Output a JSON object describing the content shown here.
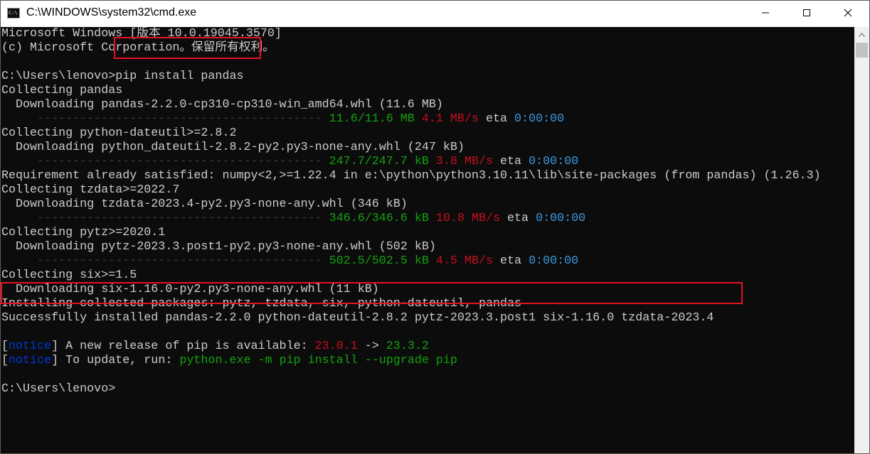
{
  "window": {
    "title": "C:\\WINDOWS\\system32\\cmd.exe",
    "app_icon_text": "C:\\"
  },
  "controls": {
    "minimize_icon": "minimize-icon",
    "maximize_icon": "maximize-icon",
    "close_icon": "close-icon"
  },
  "colors": {
    "background": "#0c0c0c",
    "text": "#cccccc",
    "green": "#13a10e",
    "red": "#c50f1f",
    "blue": "#3a96dd",
    "notice_blue": "#0037da",
    "highlight_box": "#e81123"
  },
  "console": {
    "lines": [
      [
        {
          "text": "Microsoft Windows [版本 10.0.19045.3570]"
        }
      ],
      [
        {
          "text": "(c) Microsoft Corporation。保留所有权利。"
        }
      ],
      [
        {
          "text": ""
        }
      ],
      [
        {
          "text": "C:\\Users\\lenovo>pip install pandas"
        }
      ],
      [
        {
          "text": "Collecting pandas"
        }
      ],
      [
        {
          "text": "  Downloading pandas-2.2.0-cp310-cp310-win_amd64.whl (11.6 MB)"
        }
      ],
      [
        {
          "text": "     ---------------------------------------- ",
          "color": "dash"
        },
        {
          "text": "11.6/11.6 MB",
          "color": "green"
        },
        {
          "text": " "
        },
        {
          "text": "4.1 MB/s",
          "color": "red"
        },
        {
          "text": " eta "
        },
        {
          "text": "0:00:00",
          "color": "blue"
        }
      ],
      [
        {
          "text": "Collecting python-dateutil>=2.8.2"
        }
      ],
      [
        {
          "text": "  Downloading python_dateutil-2.8.2-py2.py3-none-any.whl (247 kB)"
        }
      ],
      [
        {
          "text": "     ---------------------------------------- ",
          "color": "dash"
        },
        {
          "text": "247.7/247.7 kB",
          "color": "green"
        },
        {
          "text": " "
        },
        {
          "text": "3.8 MB/s",
          "color": "red"
        },
        {
          "text": " eta "
        },
        {
          "text": "0:00:00",
          "color": "blue"
        }
      ],
      [
        {
          "text": "Requirement already satisfied: numpy<2,>=1.22.4 in e:\\python\\python3.10.11\\lib\\site-packages (from pandas) (1.26.3)"
        }
      ],
      [
        {
          "text": "Collecting tzdata>=2022.7"
        }
      ],
      [
        {
          "text": "  Downloading tzdata-2023.4-py2.py3-none-any.whl (346 kB)"
        }
      ],
      [
        {
          "text": "     ---------------------------------------- ",
          "color": "dash"
        },
        {
          "text": "346.6/346.6 kB",
          "color": "green"
        },
        {
          "text": " "
        },
        {
          "text": "10.8 MB/s",
          "color": "red"
        },
        {
          "text": " eta "
        },
        {
          "text": "0:00:00",
          "color": "blue"
        }
      ],
      [
        {
          "text": "Collecting pytz>=2020.1"
        }
      ],
      [
        {
          "text": "  Downloading pytz-2023.3.post1-py2.py3-none-any.whl (502 kB)"
        }
      ],
      [
        {
          "text": "     ---------------------------------------- ",
          "color": "dash"
        },
        {
          "text": "502.5/502.5 kB",
          "color": "green"
        },
        {
          "text": " "
        },
        {
          "text": "4.5 MB/s",
          "color": "red"
        },
        {
          "text": " eta "
        },
        {
          "text": "0:00:00",
          "color": "blue"
        }
      ],
      [
        {
          "text": "Collecting six>=1.5"
        }
      ],
      [
        {
          "text": "  Downloading six-1.16.0-py2.py3-none-any.whl (11 kB)"
        }
      ],
      [
        {
          "text": "Installing collected packages: pytz, tzdata, six, python-dateutil, pandas"
        }
      ],
      [
        {
          "text": "Successfully installed pandas-2.2.0 python-dateutil-2.8.2 pytz-2023.3.post1 six-1.16.0 tzdata-2023.4"
        }
      ],
      [
        {
          "text": ""
        }
      ],
      [
        {
          "text": "["
        },
        {
          "text": "notice",
          "color": "dblue"
        },
        {
          "text": "] A new release of pip is available: "
        },
        {
          "text": "23.0.1",
          "color": "red"
        },
        {
          "text": " -> "
        },
        {
          "text": "23.3.2",
          "color": "green"
        }
      ],
      [
        {
          "text": "["
        },
        {
          "text": "notice",
          "color": "dblue"
        },
        {
          "text": "] To update, run: "
        },
        {
          "text": "python.exe -m pip install --upgrade pip",
          "color": "green"
        }
      ],
      [
        {
          "text": ""
        }
      ],
      [
        {
          "text": "C:\\Users\\lenovo>"
        }
      ]
    ]
  }
}
